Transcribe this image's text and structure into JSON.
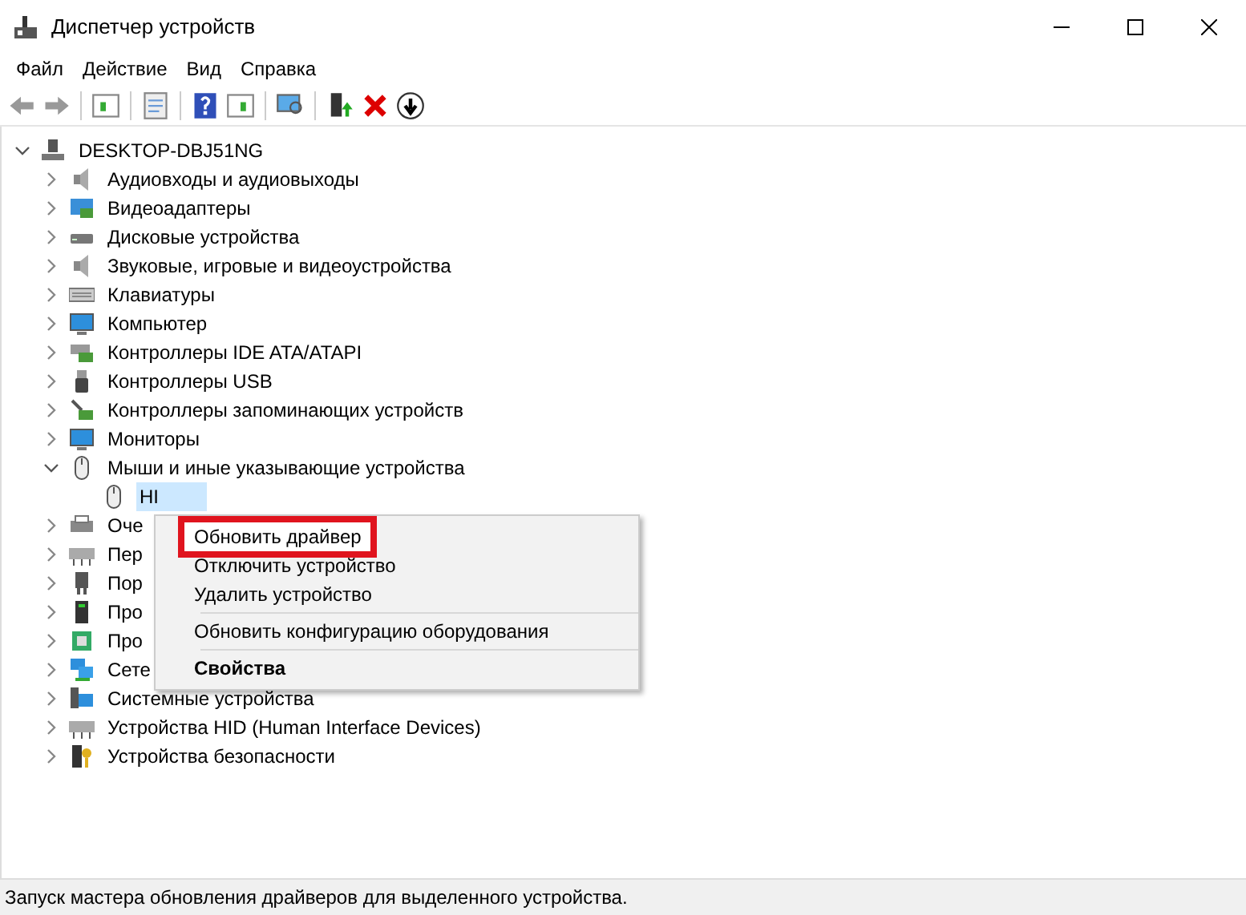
{
  "window": {
    "title": "Диспетчер устройств"
  },
  "menu_bar": [
    "Файл",
    "Действие",
    "Вид",
    "Справка"
  ],
  "tree": {
    "label": "DESKTOP-DBJ51NG",
    "expanded": true,
    "children": [
      {
        "label": "Аудиовходы и аудиовыходы",
        "expanded": false
      },
      {
        "label": "Видеоадаптеры",
        "expanded": false
      },
      {
        "label": "Дисковые устройства",
        "expanded": false
      },
      {
        "label": "Звуковые, игровые и видеоустройства",
        "expanded": false
      },
      {
        "label": "Клавиатуры",
        "expanded": false
      },
      {
        "label": "Компьютер",
        "expanded": false
      },
      {
        "label": "Контроллеры IDE ATA/ATAPI",
        "expanded": false
      },
      {
        "label": "Контроллеры USB",
        "expanded": false
      },
      {
        "label": "Контроллеры запоминающих устройств",
        "expanded": false
      },
      {
        "label": "Мониторы",
        "expanded": false
      },
      {
        "label": "Мыши и иные указывающие устройства",
        "expanded": true,
        "children": [
          {
            "label": "HI",
            "selected": true
          }
        ]
      },
      {
        "label": "Оче",
        "expanded": false
      },
      {
        "label": "Пер",
        "expanded": false
      },
      {
        "label": "Пор",
        "expanded": false
      },
      {
        "label": "Про",
        "expanded": false
      },
      {
        "label": "Про",
        "expanded": false
      },
      {
        "label": "Сете",
        "expanded": false
      },
      {
        "label": "Системные устройства",
        "expanded": false
      },
      {
        "label": "Устройства HID (Human Interface Devices)",
        "expanded": false
      },
      {
        "label": "Устройства безопасности",
        "expanded": false
      }
    ]
  },
  "context_menu": [
    {
      "kind": "item",
      "label": "Обновить драйвер",
      "highlighted": true
    },
    {
      "kind": "item",
      "label": "Отключить устройство",
      "highlighted": false
    },
    {
      "kind": "item",
      "label": "Удалить устройство",
      "highlighted": false
    },
    {
      "kind": "separator"
    },
    {
      "kind": "item",
      "label": "Обновить конфигурацию оборудования",
      "highlighted": false
    },
    {
      "kind": "separator"
    },
    {
      "kind": "default",
      "label": "Свойства",
      "highlighted": false
    }
  ],
  "status_bar": "Запуск мастера обновления драйверов для выделенного устройства."
}
